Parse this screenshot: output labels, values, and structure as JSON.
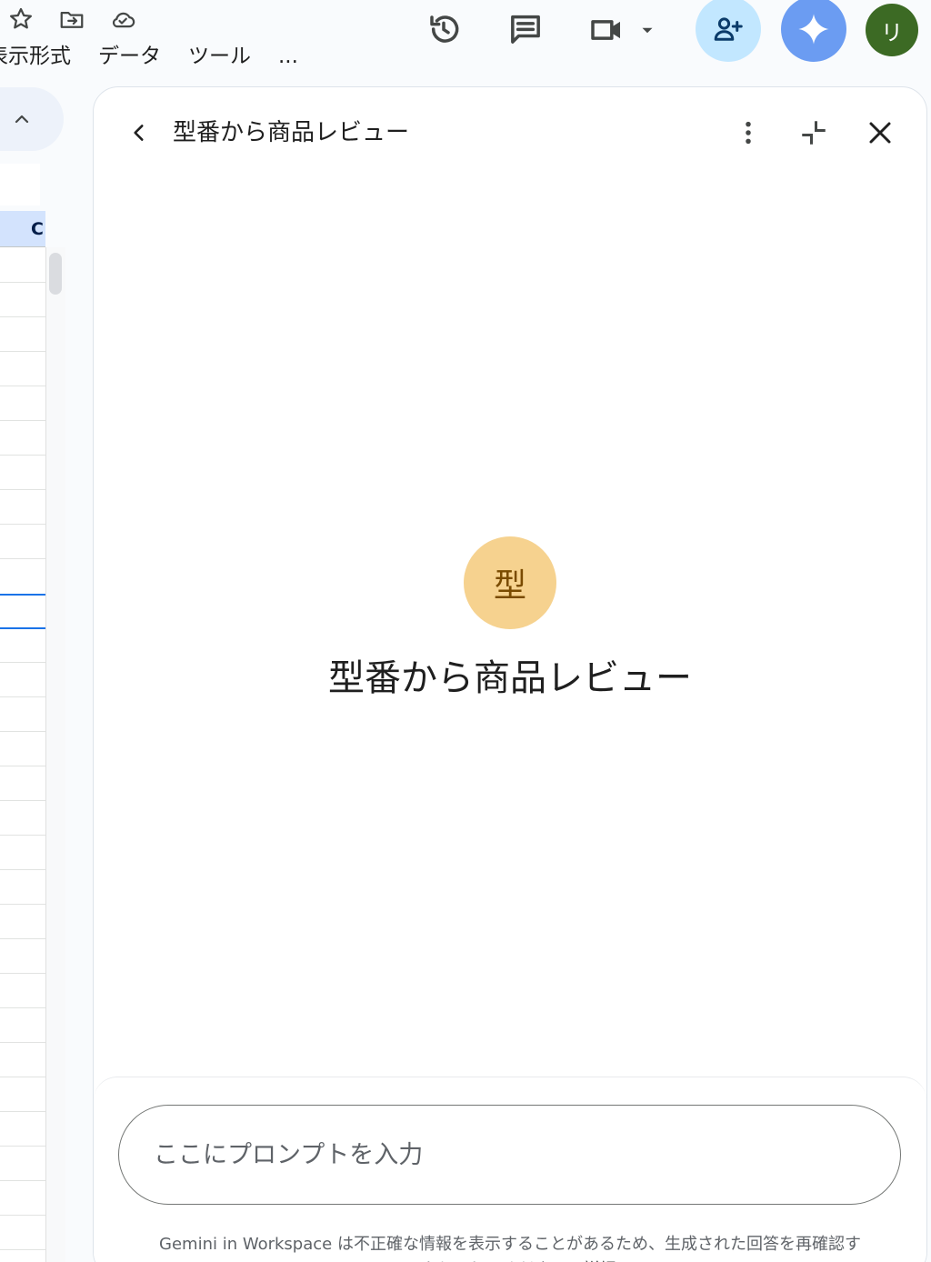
{
  "toolbar": {
    "menu": [
      "表示形式",
      "データ",
      "ツール",
      "..."
    ]
  },
  "top_right": {
    "avatar_initial": "リ"
  },
  "sheet": {
    "column_label": "C"
  },
  "panel": {
    "title": "型番から商品レビュー",
    "gem_initial": "型",
    "gem_name": "型番から商品レビュー",
    "prompt_placeholder": "ここにプロンプトを入力",
    "disclaimer_lead": "Gemini in Workspace",
    "disclaimer_text": " は不正確な情報を表示することがあるため、生成された回答を再確認するようにしてください。",
    "disclaimer_link": "詳細"
  },
  "colors": {
    "share_bg": "#c2e7ff",
    "gemini_bg": "#6b9cf2",
    "avatar_bg": "#3c6a24",
    "gem_avatar_bg": "#f6d28f",
    "selection": "#1a73e8"
  }
}
